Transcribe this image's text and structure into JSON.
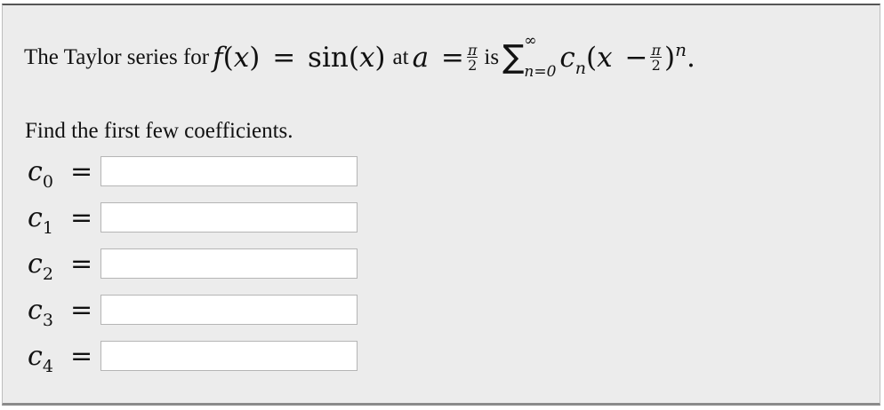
{
  "question": {
    "lead_text": "The Taylor series for",
    "f": "f",
    "open_paren": "(",
    "x": "x",
    "close_paren": ")",
    "equals": "=",
    "sin": "sin",
    "at_text": "at",
    "a": "a",
    "pi": "π",
    "two": "2",
    "is_text": "is",
    "sigma": "∑",
    "upper_limit": "∞",
    "lower_limit": "n=0",
    "c": "c",
    "n": "n",
    "minus": "−",
    "period": "."
  },
  "instruction": "Find the first few coefficients.",
  "coefficients": [
    {
      "symbol": "c",
      "index": "0",
      "equals": "=",
      "value": ""
    },
    {
      "symbol": "c",
      "index": "1",
      "equals": "=",
      "value": ""
    },
    {
      "symbol": "c",
      "index": "2",
      "equals": "=",
      "value": ""
    },
    {
      "symbol": "c",
      "index": "3",
      "equals": "=",
      "value": ""
    },
    {
      "symbol": "c",
      "index": "4",
      "equals": "=",
      "value": ""
    }
  ]
}
